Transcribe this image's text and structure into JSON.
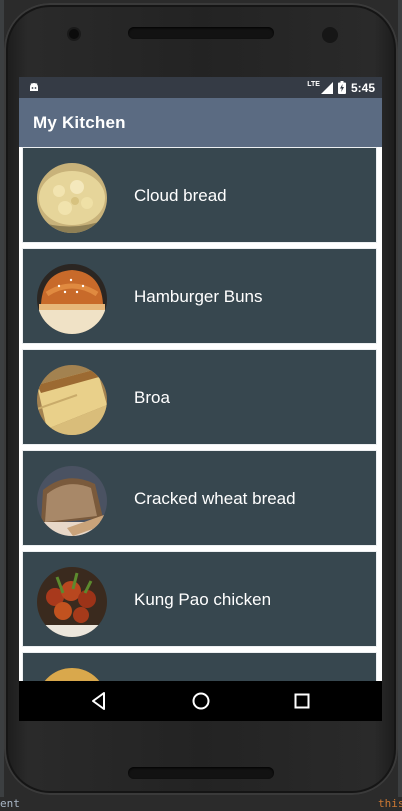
{
  "ide": {
    "left_text": "ent",
    "right_text": "this"
  },
  "statusbar": {
    "time": "5:45",
    "network": "LTE",
    "battery_charging": true,
    "accent": "#353b45"
  },
  "appbar": {
    "title": "My Kitchen",
    "color": "#5b6b82"
  },
  "recipes": [
    {
      "name": "Cloud bread"
    },
    {
      "name": "Hamburger Buns"
    },
    {
      "name": "Broa"
    },
    {
      "name": "Cracked wheat bread"
    },
    {
      "name": "Kung Pao chicken"
    },
    {
      "name": ""
    }
  ],
  "card_color": "#37474f",
  "navbar": {
    "buttons": [
      "back-icon",
      "home-icon",
      "recents-icon"
    ]
  }
}
